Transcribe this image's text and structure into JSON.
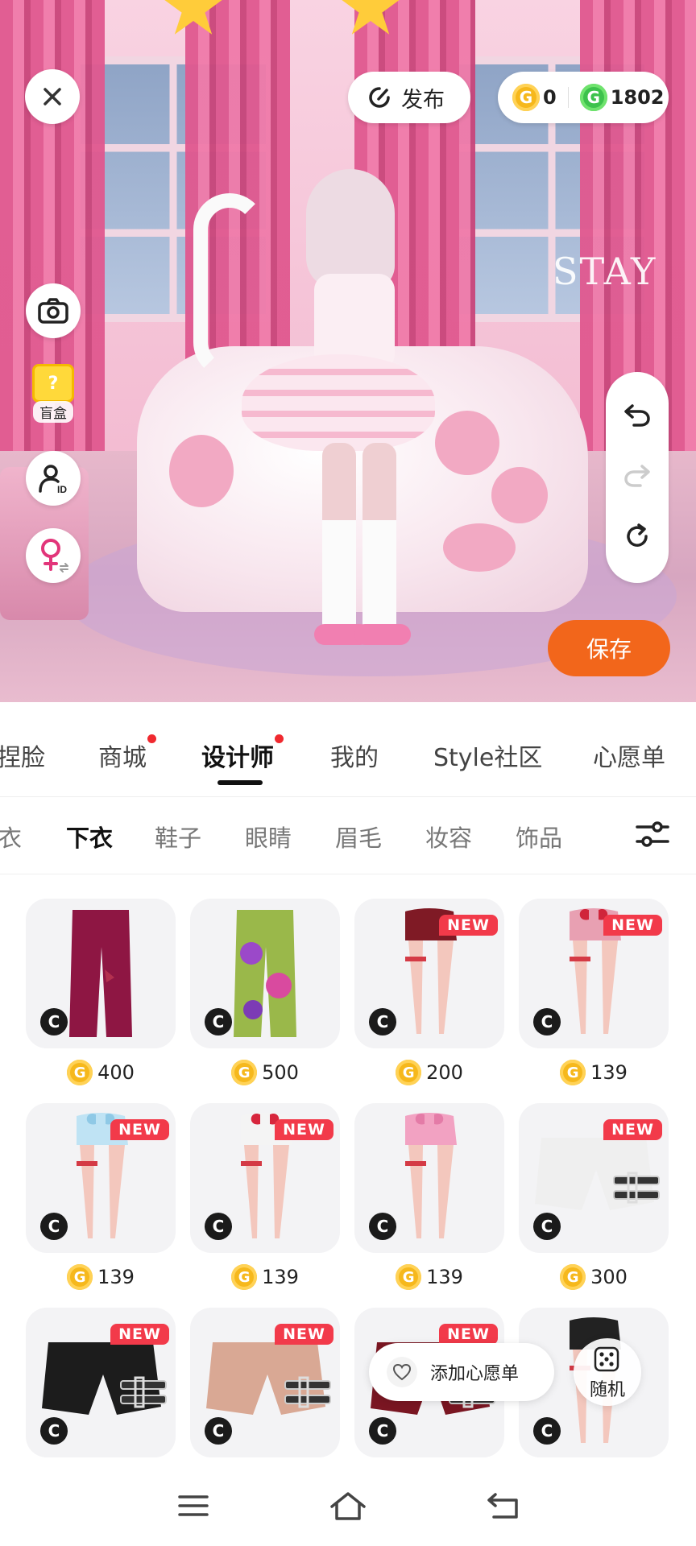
{
  "topbar": {
    "publish_label": "发布",
    "gold_balance": "0",
    "gem_balance": "1802",
    "coin_glyph": "G"
  },
  "scene": {
    "overlay_text": "STAY",
    "blind_box_label": "盲盒",
    "save_label": "保存"
  },
  "main_tabs": [
    {
      "label": "捏脸",
      "dot": false
    },
    {
      "label": "商城",
      "dot": true
    },
    {
      "label": "设计师",
      "dot": true,
      "active": true
    },
    {
      "label": "我的",
      "dot": false
    },
    {
      "label": "Style社区",
      "dot": false
    },
    {
      "label": "心愿单",
      "dot": false
    }
  ],
  "sub_tabs": [
    {
      "label": "衣"
    },
    {
      "label": "下衣",
      "active": true
    },
    {
      "label": "鞋子"
    },
    {
      "label": "眼睛"
    },
    {
      "label": "眉毛"
    },
    {
      "label": "妆容"
    },
    {
      "label": "饰品"
    }
  ],
  "items": [
    {
      "price": "400",
      "new": false,
      "thumb": "dark-red-pants"
    },
    {
      "price": "500",
      "new": false,
      "thumb": "green-floral-pants"
    },
    {
      "price": "200",
      "new": true,
      "thumb": "dark-red-shorts-legs"
    },
    {
      "price": "139",
      "new": true,
      "thumb": "red-plaid-shorts-legs"
    },
    {
      "price": "139",
      "new": true,
      "thumb": "blue-bow-shorts-legs"
    },
    {
      "price": "139",
      "new": true,
      "thumb": "white-red-bow-shorts-legs"
    },
    {
      "price": "139",
      "new": false,
      "thumb": "pink-plaid-shorts-legs"
    },
    {
      "price": "300",
      "new": true,
      "thumb": "white-buckle-shorts"
    },
    {
      "price": "",
      "new": true,
      "thumb": "black-buckle-shorts"
    },
    {
      "price": "",
      "new": true,
      "thumb": "beige-buckle-shorts"
    },
    {
      "price": "",
      "new": true,
      "thumb": "maroon-buckle-shorts"
    },
    {
      "price": "",
      "new": false,
      "thumb": "black-shorts-legs"
    }
  ],
  "new_label": "NEW",
  "creator_badge": "C",
  "wishlist_add_label": "添加心愿单",
  "random_label": "随机",
  "colors": {
    "save_orange": "#f2661b",
    "new_red": "#f23a4a",
    "gold_coin": "#f6b81c",
    "gem_green": "#3dc24c",
    "notification_dot": "#f0292f"
  }
}
